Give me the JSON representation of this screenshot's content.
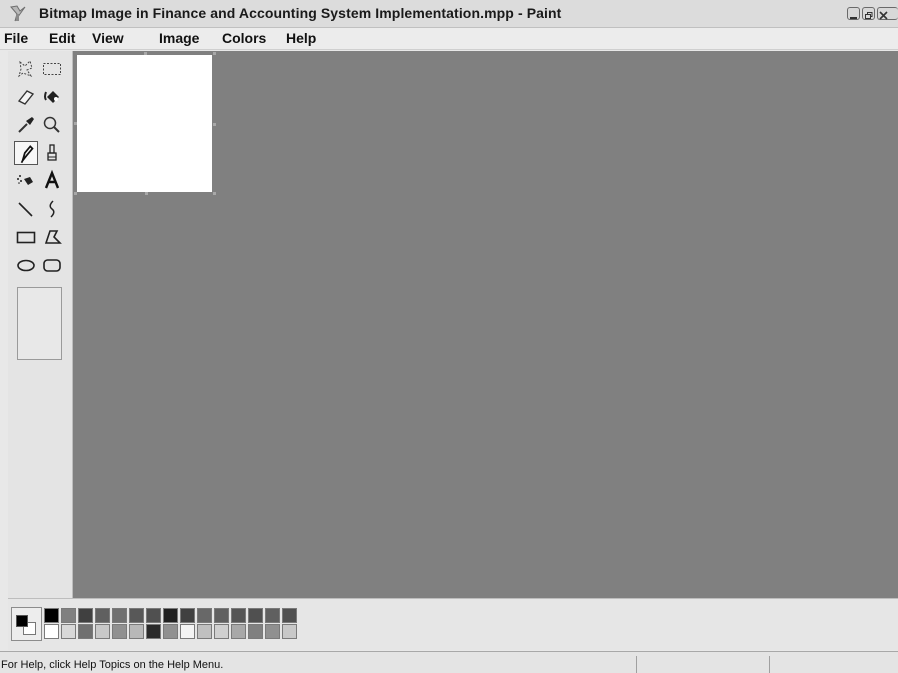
{
  "window": {
    "title": "Bitmap Image in Finance and Accounting System Implementation.mpp - Paint",
    "app_icon": "paint-icon"
  },
  "menu": {
    "items": [
      {
        "label": "File"
      },
      {
        "label": "Edit"
      },
      {
        "label": "View"
      },
      {
        "label": "Image"
      },
      {
        "label": "Colors"
      },
      {
        "label": "Help"
      }
    ]
  },
  "toolbox": {
    "tools": [
      {
        "name": "free-form-select",
        "icon": "free-form-select-icon"
      },
      {
        "name": "rectangle-select",
        "icon": "rectangle-select-icon"
      },
      {
        "name": "eraser",
        "icon": "eraser-icon"
      },
      {
        "name": "fill",
        "icon": "fill-bucket-icon"
      },
      {
        "name": "pick-color",
        "icon": "eyedropper-icon"
      },
      {
        "name": "magnifier",
        "icon": "magnifier-icon"
      },
      {
        "name": "pencil",
        "icon": "pencil-icon",
        "selected": true
      },
      {
        "name": "brush",
        "icon": "brush-icon"
      },
      {
        "name": "airbrush",
        "icon": "airbrush-icon"
      },
      {
        "name": "text",
        "icon": "text-icon",
        "glyph": "A"
      },
      {
        "name": "line",
        "icon": "line-icon"
      },
      {
        "name": "curve",
        "icon": "curve-icon"
      },
      {
        "name": "rectangle",
        "icon": "rectangle-icon"
      },
      {
        "name": "polygon",
        "icon": "polygon-icon"
      },
      {
        "name": "ellipse",
        "icon": "ellipse-icon"
      },
      {
        "name": "rounded-rectangle",
        "icon": "rounded-rectangle-icon"
      }
    ]
  },
  "colors": {
    "foreground": "#000000",
    "background": "#ffffff",
    "palette_top": [
      "#000000",
      "#808080",
      "#404040",
      "#606060",
      "#707070",
      "#585858",
      "#505050",
      "#202020",
      "#404040",
      "#686868",
      "#606060",
      "#555555",
      "#505050",
      "#606060",
      "#505050"
    ],
    "palette_bottom": [
      "#ffffff",
      "#d8d8d8",
      "#707070",
      "#c8c8c8",
      "#909090",
      "#b8b8b8",
      "#2a2a2a",
      "#909090",
      "#f4f4f4",
      "#c0c0c0",
      "#d0d0d0",
      "#a8a8a8",
      "#808080",
      "#909090",
      "#c8c8c8"
    ]
  },
  "status": {
    "text": "For Help, click Help Topics on the Help Menu."
  }
}
